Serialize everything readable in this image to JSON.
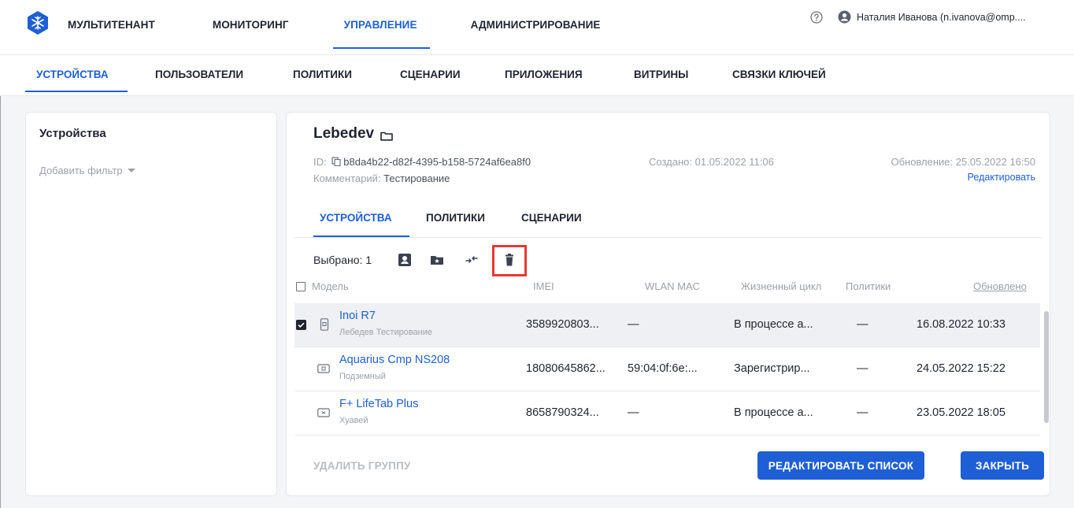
{
  "colors": {
    "accent": "#1e5fd6",
    "danger_highlight": "#e53935",
    "text": "#1f2430",
    "muted": "#9aa0aa"
  },
  "top_nav": {
    "tabs": [
      {
        "label": "МУЛЬТИТЕНАНТ"
      },
      {
        "label": "МОНИТОРИНГ"
      },
      {
        "label": "УПРАВЛЕНИЕ",
        "active": true
      },
      {
        "label": "АДМИНИСТРИРОВАНИЕ"
      }
    ],
    "user_name": "Наталия Иванова (n.ivanova@omp...."
  },
  "sub_nav": {
    "tabs": [
      {
        "label": "УСТРОЙСТВА",
        "active": true
      },
      {
        "label": "ПОЛЬЗОВАТЕЛИ"
      },
      {
        "label": "ПОЛИТИКИ"
      },
      {
        "label": "СЦЕНАРИИ"
      },
      {
        "label": "ПРИЛОЖЕНИЯ"
      },
      {
        "label": "ВИТРИНЫ"
      },
      {
        "label": "СВЯЗКИ КЛЮЧЕЙ"
      }
    ]
  },
  "left_panel": {
    "title": "Устройства",
    "add_filter": "Добавить фильтр"
  },
  "group": {
    "name": "Lebedev",
    "id_label": "ID:",
    "id_value": "b8da4b22-d82f-4395-b158-5724af6ea8f0",
    "comment_label": "Комментарий:",
    "comment_value": "Тестирование",
    "created_label": "Создано:",
    "created_value": "01.05.2022 11:06",
    "updated_label": "Обновление:",
    "updated_value": "25.05.2022 16:50",
    "edit_link": "Редактировать"
  },
  "inner_tabs": [
    {
      "label": "УСТРОЙСТВА",
      "active": true
    },
    {
      "label": "ПОЛИТИКИ"
    },
    {
      "label": "СЦЕНАРИИ"
    }
  ],
  "toolbar": {
    "selected_label": "Выбрано: 1"
  },
  "table": {
    "headers": {
      "model": "Модель",
      "imei": "IMEI",
      "wlan": "WLAN MAC",
      "lifecycle": "Жизненный цикл",
      "policies": "Политики",
      "updated": "Обновлено"
    },
    "rows": [
      {
        "name": "Inoi R7",
        "sub": "Лебедев Тестирование",
        "imei": "3589920803...",
        "wlan": "—",
        "lifecycle": "В процессе а...",
        "policies": "—",
        "updated": "16.08.2022 10:33",
        "checked": true,
        "device": "phone"
      },
      {
        "name": "Aquarius Cmp NS208",
        "sub": "Подземный",
        "imei": "18080645862...",
        "wlan": "59:04:0f:6e:...",
        "lifecycle": "Зарегистрир...",
        "policies": "—",
        "updated": "24.05.2022 15:22",
        "checked": false,
        "device": "tablet"
      },
      {
        "name": "F+ LifeTab Plus",
        "sub": "Хуавей",
        "imei": "8658790324...",
        "wlan": "—",
        "lifecycle": "В процессе а...",
        "policies": "—",
        "updated": "23.05.2022 18:05",
        "checked": false,
        "device": "tablet"
      }
    ]
  },
  "footer": {
    "delete_group": "УДАЛИТЬ ГРУППУ",
    "edit_list": "РЕДАКТИРОВАТЬ СПИСОК",
    "close": "ЗАКРЫТЬ"
  }
}
